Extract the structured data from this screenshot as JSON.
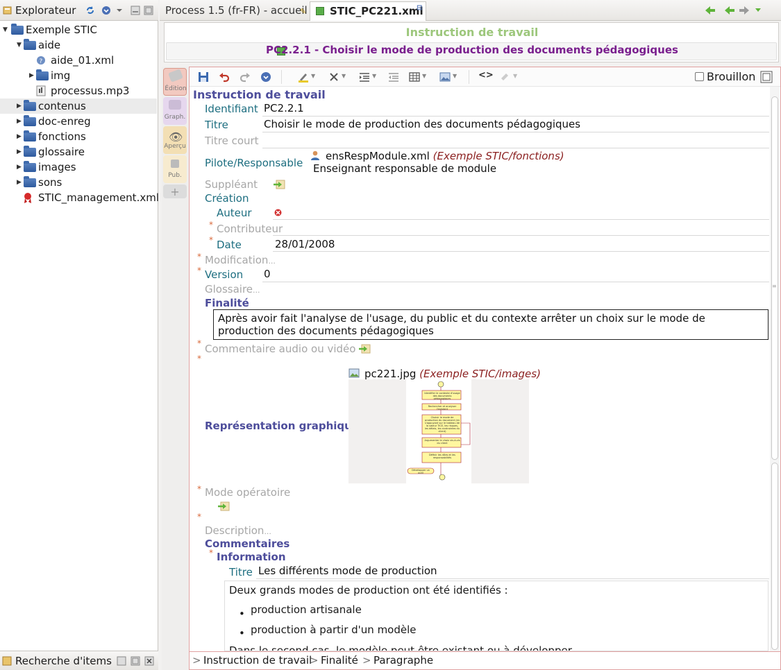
{
  "explorer": {
    "title": "Explorateur",
    "search_title": "Recherche d'items",
    "tree": [
      {
        "label": "Exemple STIC"
      },
      {
        "label": "aide"
      },
      {
        "label": "aide_01.xml"
      },
      {
        "label": "img"
      },
      {
        "label": "processus.mp3"
      },
      {
        "label": "contenus"
      },
      {
        "label": "doc-enreg"
      },
      {
        "label": "fonctions"
      },
      {
        "label": "glossaire"
      },
      {
        "label": "images"
      },
      {
        "label": "sons"
      },
      {
        "label": "STIC_management.xml"
      }
    ]
  },
  "tabs": [
    {
      "label": "Process 1.5 (fr-FR) - accueil"
    },
    {
      "label": "STIC_PC221.xml"
    }
  ],
  "header": {
    "title": "Instruction de travail",
    "subtitle": "PC2.2.1 - Choisir le mode de production des documents pédagogiques"
  },
  "side_tabs": [
    {
      "label": "Édition"
    },
    {
      "label": "Graph."
    },
    {
      "label": "Aperçu"
    },
    {
      "label": "Pub."
    }
  ],
  "toolbar": {
    "draft_label": "Brouillon",
    "tag_label": "<>"
  },
  "form": {
    "root": "Instruction de travail",
    "identifiant_label": "Identifiant",
    "identifiant": "PC2.2.1",
    "titre_label": "Titre",
    "titre": "Choisir le mode de production des documents pédagogiques",
    "titre_court_label": "Titre court",
    "pilote_label": "Pilote/Responsable",
    "pilote_file": "ensRespModule.xml",
    "pilote_path": "(Exemple STIC/fonctions)",
    "pilote_desc": "Enseignant responsable de module",
    "suppleant_label": "Suppléant",
    "creation_label": "Création",
    "auteur_label": "Auteur",
    "contributeur_label": "Contributeur",
    "date_label": "Date",
    "date": "28/01/2008",
    "modification_label": "Modification",
    "version_label": "Version",
    "version": "0",
    "glossaire_label": "Glossaire",
    "ellipsis": "...",
    "finalite_label": "Finalité",
    "finalite_text": "Après avoir fait l'analyse de l'usage, du public et du contexte arrêter un choix sur le mode de production des documents pédagogiques",
    "commentaire_av_label": "Commentaire audio ou vidéo",
    "image_file": "pc221.jpg",
    "image_path": "(Exemple STIC/images)",
    "representation_label": "Représentation graphique",
    "mode_label": "Mode opératoire",
    "description_label": "Description",
    "commentaires_label": "Commentaires",
    "information_label": "Information",
    "info_titre_label": "Titre",
    "info_titre": "Les différents mode de production",
    "para1": "Deux grands modes de production ont été identifiés :",
    "bullets": [
      "production artisanale",
      "production à partir d'un modèle"
    ],
    "para2": "Dans le second cas, le modèle peut être existant ou à développer"
  },
  "breadcrumb": [
    "Instruction de travail",
    "Finalité",
    "Paragraphe"
  ],
  "flow_box_text": [
    "Identifier le contexte d'usage des documents pédagogiques",
    "Rechercher et analyser l'existant",
    "Choisir le mode de production du document (en s'appuyant sur le tableau de la valeur TICE, les risques, les délais, les contraintes du client)",
    "Argumenter le choix vis-à-vis du client",
    "Définir les rôles et les responsabilités",
    "Développer un outil"
  ],
  "colors": {
    "accent_green": "#9dc77c",
    "purple": "#7a1f8e",
    "navy": "#4d4d9b",
    "teal": "#1d6e80"
  }
}
